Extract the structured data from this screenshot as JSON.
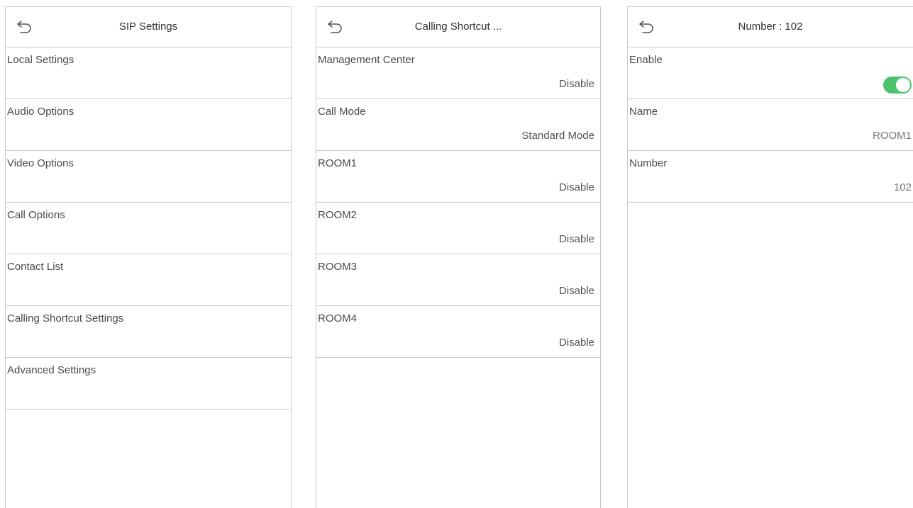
{
  "colors": {
    "accent": "#4cc36b",
    "divider": "#c8c8c8"
  },
  "panel1": {
    "title": "SIP Settings",
    "items": [
      {
        "label": "Local Settings"
      },
      {
        "label": "Audio Options"
      },
      {
        "label": "Video Options"
      },
      {
        "label": "Call Options"
      },
      {
        "label": "Contact List"
      },
      {
        "label": "Calling Shortcut Settings"
      },
      {
        "label": "Advanced Settings"
      }
    ]
  },
  "panel2": {
    "title": "Calling Shortcut ...",
    "items": [
      {
        "label": "Management Center",
        "value": "Disable"
      },
      {
        "label": "Call Mode",
        "value": "Standard Mode"
      },
      {
        "label": "ROOM1",
        "value": "Disable"
      },
      {
        "label": "ROOM2",
        "value": "Disable"
      },
      {
        "label": "ROOM3",
        "value": "Disable"
      },
      {
        "label": "ROOM4",
        "value": "Disable"
      }
    ]
  },
  "panel3": {
    "title": "Number : 102",
    "enable": {
      "label": "Enable",
      "on": true
    },
    "name": {
      "label": "Name",
      "value": "ROOM1"
    },
    "number": {
      "label": "Number",
      "value": "102"
    }
  }
}
